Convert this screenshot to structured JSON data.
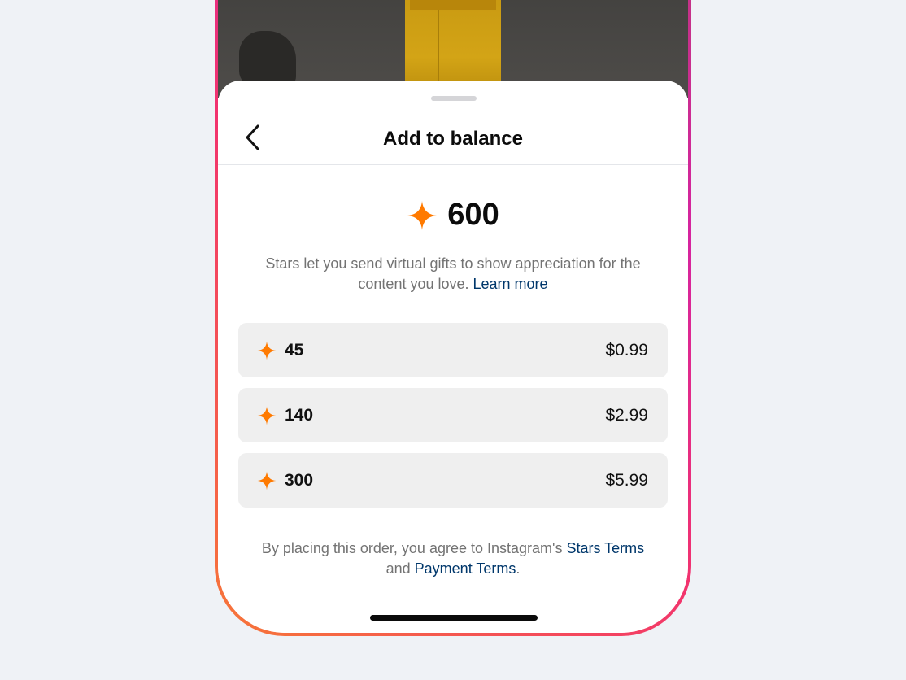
{
  "sheet": {
    "title": "Add to balance",
    "balance": "600",
    "description": "Stars let you send virtual gifts to show appreciation for the content you love.",
    "learn_more": "Learn more"
  },
  "packs": [
    {
      "stars": "45",
      "price": "$0.99"
    },
    {
      "stars": "140",
      "price": "$2.99"
    },
    {
      "stars": "300",
      "price": "$5.99"
    }
  ],
  "terms": {
    "prefix": "By placing this order, you agree to Instagram's",
    "stars_terms": "Stars Terms",
    "and": "and",
    "payment_terms": "Payment Terms",
    "suffix": "."
  },
  "colors": {
    "star": "#ff7a00",
    "link": "#00376b",
    "frame_gradient": [
      "#f77737",
      "#f2336e",
      "#d6249f",
      "#c13584"
    ]
  },
  "icons": {
    "back": "chevron-left-icon",
    "star": "star-sparkle-icon"
  }
}
